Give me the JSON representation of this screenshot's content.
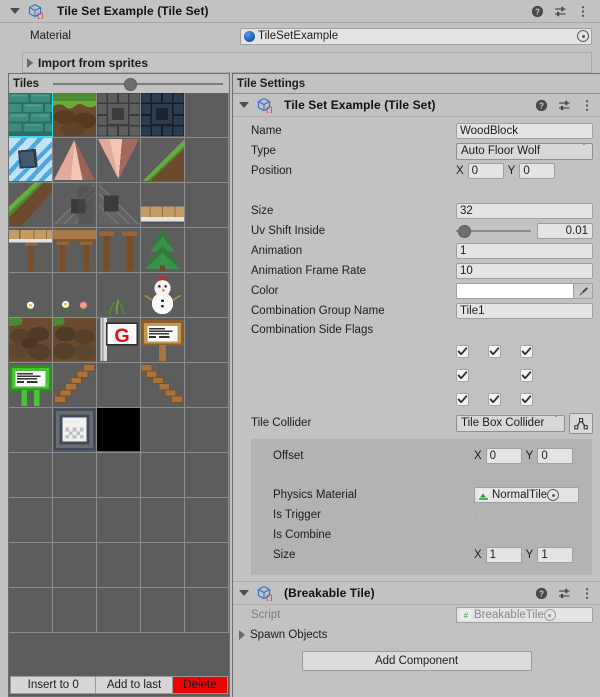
{
  "header": {
    "title": "Tile Set Example (Tile Set)",
    "icon": "scriptable-object-cube-icon",
    "help_icon": "help-icon",
    "preset_icon": "preset-icon",
    "menu_icon": "kebab-menu-icon"
  },
  "material_row": {
    "label": "Material",
    "value": "TileSetExample"
  },
  "import_bar": {
    "label": "Import from sprites"
  },
  "tiles_panel": {
    "title": "Tiles",
    "zoom_slider_percent": 42,
    "selected_index": 0,
    "footer": {
      "insert_label": "Insert to 0",
      "add_label": "Add to last",
      "delete_label": "Delete",
      "delete_color": "#f00000"
    },
    "tiles": [
      {
        "name": "teal-brick",
        "art": "teal-brick"
      },
      {
        "name": "grass-dirt",
        "art": "grass-dirt"
      },
      {
        "name": "gray-stone-brick",
        "art": "gray-stone"
      },
      {
        "name": "blue-stone-brick",
        "art": "blue-stone"
      },
      {
        "name": "empty",
        "art": ""
      },
      {
        "name": "blue-stripe-hole",
        "art": "blue-stripe"
      },
      {
        "name": "pink-cone-up",
        "art": "cone-up"
      },
      {
        "name": "pink-cone-down",
        "art": "cone-down"
      },
      {
        "name": "grass-slope",
        "art": "grass-slope"
      },
      {
        "name": "empty",
        "art": ""
      },
      {
        "name": "grass-slope-2",
        "art": "grass-slope2"
      },
      {
        "name": "stone-roof",
        "art": "stone-roof"
      },
      {
        "name": "stone-roof-right",
        "art": "stone-roof-r"
      },
      {
        "name": "wood-plank-top",
        "art": "plank"
      },
      {
        "name": "empty",
        "art": ""
      },
      {
        "name": "wood-platform-left",
        "art": "platform-l"
      },
      {
        "name": "wood-platform-mid",
        "art": "platform-m"
      },
      {
        "name": "wood-pillars",
        "art": "pillars"
      },
      {
        "name": "pine-tree",
        "art": "tree"
      },
      {
        "name": "empty",
        "art": ""
      },
      {
        "name": "flower-white",
        "art": "flower1"
      },
      {
        "name": "flowers-pair",
        "art": "flower2"
      },
      {
        "name": "grass-sprout",
        "art": "sprout"
      },
      {
        "name": "snowman",
        "art": "snowman"
      },
      {
        "name": "empty",
        "art": ""
      },
      {
        "name": "rock-ground",
        "art": "rocks"
      },
      {
        "name": "rock-ground-2",
        "art": "rocks2"
      },
      {
        "name": "goal-flag",
        "art": "flag"
      },
      {
        "name": "sign-post",
        "art": "sign"
      },
      {
        "name": "empty",
        "art": ""
      },
      {
        "name": "sign-green",
        "art": "sign-green"
      },
      {
        "name": "stairs-up",
        "art": "stairs"
      },
      {
        "name": "empty",
        "art": ""
      },
      {
        "name": "stairs-up-2",
        "art": "stairs2"
      },
      {
        "name": "empty",
        "art": ""
      },
      {
        "name": "empty",
        "art": ""
      },
      {
        "name": "window-frame",
        "art": "window"
      },
      {
        "name": "black-block",
        "art": "black"
      },
      {
        "name": "empty",
        "art": ""
      },
      {
        "name": "empty",
        "art": ""
      },
      {
        "name": "empty",
        "art": ""
      },
      {
        "name": "empty",
        "art": ""
      },
      {
        "name": "empty",
        "art": ""
      },
      {
        "name": "empty",
        "art": ""
      },
      {
        "name": "empty",
        "art": ""
      },
      {
        "name": "empty",
        "art": ""
      },
      {
        "name": "empty",
        "art": ""
      },
      {
        "name": "empty",
        "art": ""
      },
      {
        "name": "empty",
        "art": ""
      },
      {
        "name": "empty",
        "art": ""
      },
      {
        "name": "empty",
        "art": ""
      },
      {
        "name": "empty",
        "art": ""
      },
      {
        "name": "empty",
        "art": ""
      },
      {
        "name": "empty",
        "art": ""
      },
      {
        "name": "empty",
        "art": ""
      },
      {
        "name": "empty",
        "art": ""
      },
      {
        "name": "empty",
        "art": ""
      },
      {
        "name": "empty",
        "art": ""
      },
      {
        "name": "empty",
        "art": ""
      },
      {
        "name": "empty",
        "art": ""
      }
    ]
  },
  "settings_panel": {
    "title": "Tile Settings",
    "component": {
      "title": "Tile Set Example (Tile Set)"
    },
    "name": {
      "label": "Name",
      "value": "WoodBlock"
    },
    "type": {
      "label": "Type",
      "value": "Auto Floor Wolf"
    },
    "position": {
      "label": "Position",
      "x_label": "X",
      "x": "0",
      "y_label": "Y",
      "y": "0"
    },
    "size": {
      "label": "Size",
      "value": "32"
    },
    "uv_shift": {
      "label": "Uv Shift Inside",
      "value": "0.01",
      "slider_percent": 3
    },
    "animation": {
      "label": "Animation",
      "value": "1"
    },
    "animation_frame_rate": {
      "label": "Animation Frame Rate",
      "value": "10"
    },
    "color": {
      "label": "Color",
      "value": "#ffffff",
      "eyedropper_icon": "eyedropper-icon"
    },
    "combination_group_name": {
      "label": "Combination Group Name",
      "value": "Tile1"
    },
    "combination_side_flags": {
      "label": "Combination Side Flags",
      "rows": [
        [
          true,
          true,
          true
        ],
        [
          true,
          null,
          true
        ],
        [
          true,
          true,
          true
        ]
      ]
    },
    "tile_collider": {
      "label": "Tile Collider",
      "value": "Tile Box Collider",
      "edit_icon": "edit-collider-icon"
    },
    "collider_box": {
      "offset": {
        "label": "Offset",
        "x_label": "X",
        "x": "0",
        "y_label": "Y",
        "y": "0"
      },
      "physics_material": {
        "label": "Physics Material",
        "value": "NormalTile"
      },
      "is_trigger": {
        "label": "Is Trigger",
        "checked": false
      },
      "is_combine": {
        "label": "Is Combine",
        "checked": false
      },
      "size": {
        "label": "Size",
        "x_label": "X",
        "x": "1",
        "y_label": "Y",
        "y": "1"
      }
    }
  },
  "breakable_component": {
    "title": "(Breakable Tile)",
    "script": {
      "label": "Script",
      "value": "BreakableTile"
    },
    "spawn_objects": {
      "label": "Spawn Objects"
    }
  },
  "add_component": {
    "label": "Add Component"
  }
}
